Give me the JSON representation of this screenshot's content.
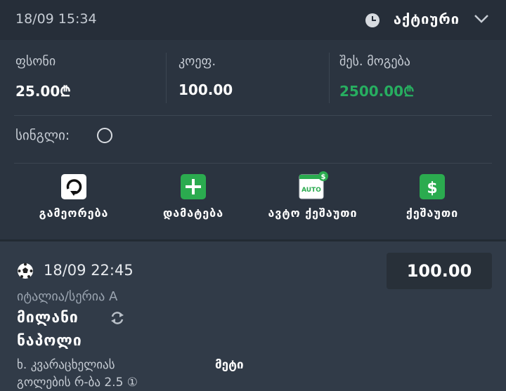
{
  "header": {
    "datetime": "18/09 15:34",
    "status": "აქტიური"
  },
  "stats": {
    "stake_label": "ფსონი",
    "stake_value": "25.00₾",
    "odds_label": "კოეფ.",
    "odds_value": "100.00",
    "payout_label": "შეს. მოგება",
    "payout_value": "2500.00₾"
  },
  "single_label": "სინგლი:",
  "actions": [
    {
      "label": "გამეორება",
      "icon": "repeat-icon"
    },
    {
      "label": "დამატება",
      "icon": "add-icon"
    },
    {
      "label": "ავტო ქეშაუთი",
      "icon": "auto-cashout-icon",
      "badge": "AUTO"
    },
    {
      "label": "ქეშაუთი",
      "icon": "cashout-icon"
    }
  ],
  "bet": {
    "datetime": "18/09 22:45",
    "odds": "100.00",
    "league": "იტალია/სერია A",
    "home": "მილანი",
    "away": "ნაპოლი",
    "market": "ხ. კვარაცხელიას",
    "selection": "მეტი",
    "submarket": "გოლების რ-ბა 2.5 ①"
  },
  "colors": {
    "accent_green": "#2bab4f",
    "payout_green": "#27ae60",
    "background": "#2b3440"
  }
}
